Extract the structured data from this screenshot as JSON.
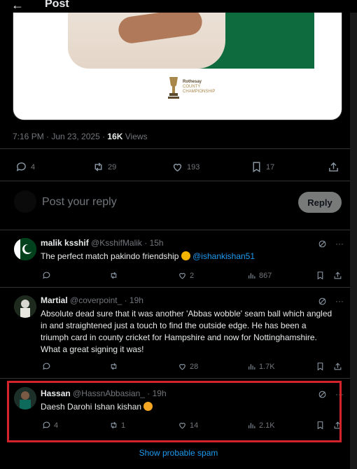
{
  "header": {
    "back_icon": "back-arrow-icon",
    "title": "Post"
  },
  "media": {
    "logo_lines": [
      "Rothesay",
      "COUNTY",
      "CHAMPIONSHIP"
    ],
    "colors": {
      "green": "#0d6b3d",
      "shirt": "#ede3d9"
    }
  },
  "post": {
    "time": "7:16 PM · Jun 23, 2025 · ",
    "views_count": "16K",
    "views_label": " Views",
    "actions": {
      "replies": "4",
      "reposts": "29",
      "likes": "193",
      "bookmarks": "17"
    }
  },
  "composer": {
    "placeholder": "Post your reply",
    "reply_label": "Reply"
  },
  "replies": [
    {
      "name": "malik ksshif",
      "handle": "@KsshifMalik · 15h",
      "text": "The perfect match pakindo friendship ",
      "mention": "@ishankishan51",
      "replies": "",
      "reposts": "",
      "likes": "2",
      "views": "867"
    },
    {
      "name": "Martial",
      "handle": "@coverpoint_ · 19h",
      "text": "Absolute dead sure that it was another 'Abbas wobble' seam ball which angled in and straightened just a touch to find the outside edge. He has been a triumph card in county cricket for Hampshire and now for Nottinghamshire. What a great signing it was!",
      "replies": "",
      "reposts": "",
      "likes": "28",
      "views": "1.7K"
    },
    {
      "name": "Hassan",
      "handle": "@HassnAbbasian_ · 19h",
      "text": "Daesh Darohi Ishan kishan ",
      "replies": "4",
      "reposts": "1",
      "likes": "14",
      "views": "2.1K"
    }
  ],
  "spam_link": "Show probable spam",
  "colors": {
    "accent": "#1d9bf0",
    "highlight_border": "#d3242c",
    "muted": "#71767b"
  }
}
